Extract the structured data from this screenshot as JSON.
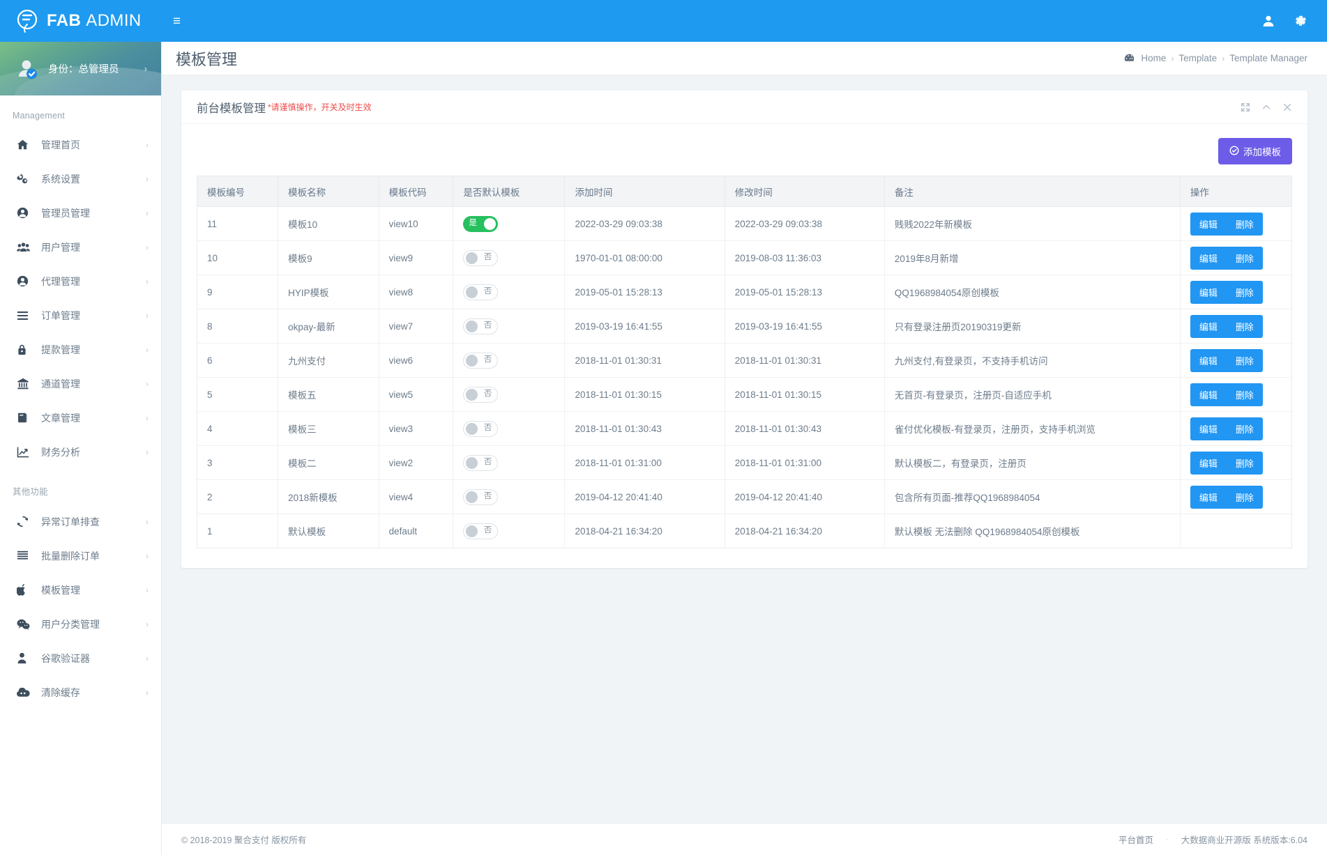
{
  "topbar": {
    "brand_bold": "FAB",
    "brand_light": "ADMIN",
    "menu_toggle": "≡",
    "icons": [
      {
        "name": "user-icon",
        "glyph": "user"
      },
      {
        "name": "gear-icon",
        "glyph": "gear"
      }
    ],
    "brand_color": "#1e9af0"
  },
  "sidebar": {
    "profile": {
      "label": "身份：总管理员",
      "arrow": "›"
    },
    "sections": [
      {
        "title": "Management",
        "items": [
          {
            "label": "管理首页",
            "icon": "home-icon",
            "arrow": "›"
          },
          {
            "label": "系统设置",
            "icon": "cogs-icon",
            "arrow": "›"
          },
          {
            "label": "管理员管理",
            "icon": "user-circle-icon",
            "arrow": "›"
          },
          {
            "label": "用户管理",
            "icon": "users-icon",
            "arrow": "›"
          },
          {
            "label": "代理管理",
            "icon": "user-circle-icon",
            "arrow": "›"
          },
          {
            "label": "订单管理",
            "icon": "list-icon",
            "arrow": "›"
          },
          {
            "label": "提款管理",
            "icon": "lock-icon",
            "arrow": "›"
          },
          {
            "label": "通道管理",
            "icon": "bank-icon",
            "arrow": "›"
          },
          {
            "label": "文章管理",
            "icon": "book-icon",
            "arrow": "›"
          },
          {
            "label": "财务分析",
            "icon": "chart-line-icon",
            "arrow": "›"
          }
        ]
      },
      {
        "title": "其他功能",
        "items": [
          {
            "label": "异常订单排查",
            "icon": "refresh-icon",
            "arrow": "›"
          },
          {
            "label": "批量删除订单",
            "icon": "bars-icon",
            "arrow": "›"
          },
          {
            "label": "模板管理",
            "icon": "apple-icon",
            "arrow": "›"
          },
          {
            "label": "用户分类管理",
            "icon": "wechat-icon",
            "arrow": "›"
          },
          {
            "label": "谷歌验证器",
            "icon": "person-icon",
            "arrow": "›"
          },
          {
            "label": "清除缓存",
            "icon": "cloud-icon",
            "arrow": "›"
          }
        ]
      }
    ]
  },
  "page": {
    "title": "模板管理",
    "breadcrumb": {
      "icon": "dashboard-icon",
      "crumbs": [
        "Home",
        "Template",
        "Template Manager"
      ],
      "separator": "›"
    }
  },
  "card": {
    "title": "前台模板管理",
    "warning": "*请谨慎操作，开关及时生效",
    "tools": [
      {
        "name": "expand-icon",
        "glyph": "expand"
      },
      {
        "name": "collapse-icon",
        "glyph": "chevron-up"
      },
      {
        "name": "close-icon",
        "glyph": "close"
      }
    ],
    "add_button": {
      "label": "添加模板",
      "icon": "check-circle-icon",
      "color": "#6c5ce7"
    }
  },
  "table": {
    "columns": [
      "模板编号",
      "模板名称",
      "模板代码",
      "是否默认模板",
      "添加时间",
      "修改时间",
      "备注",
      "操作"
    ],
    "switch_labels": {
      "on": "是",
      "off": "否"
    },
    "actions": {
      "edit": "编辑",
      "delete": "删除"
    },
    "rows": [
      {
        "id": "11",
        "name": "模板10",
        "code": "view10",
        "is_default": true,
        "created": "2022-03-29 09:03:38",
        "modified": "2022-03-29 09:03:38",
        "remark": "贱贱2022年新模板",
        "has_actions": true
      },
      {
        "id": "10",
        "name": "模板9",
        "code": "view9",
        "is_default": false,
        "created": "1970-01-01 08:00:00",
        "modified": "2019-08-03 11:36:03",
        "remark": "2019年8月新增",
        "has_actions": true
      },
      {
        "id": "9",
        "name": "HYIP模板",
        "code": "view8",
        "is_default": false,
        "created": "2019-05-01 15:28:13",
        "modified": "2019-05-01 15:28:13",
        "remark": "QQ1968984054原创模板",
        "has_actions": true
      },
      {
        "id": "8",
        "name": "okpay-最新",
        "code": "view7",
        "is_default": false,
        "created": "2019-03-19 16:41:55",
        "modified": "2019-03-19 16:41:55",
        "remark": "只有登录注册页20190319更新",
        "has_actions": true
      },
      {
        "id": "6",
        "name": "九州支付",
        "code": "view6",
        "is_default": false,
        "created": "2018-11-01 01:30:31",
        "modified": "2018-11-01 01:30:31",
        "remark": "九州支付,有登录页，不支持手机访问",
        "has_actions": true
      },
      {
        "id": "5",
        "name": "模板五",
        "code": "view5",
        "is_default": false,
        "created": "2018-11-01 01:30:15",
        "modified": "2018-11-01 01:30:15",
        "remark": "无首页-有登录页，注册页-自适应手机",
        "has_actions": true
      },
      {
        "id": "4",
        "name": "模板三",
        "code": "view3",
        "is_default": false,
        "created": "2018-11-01 01:30:43",
        "modified": "2018-11-01 01:30:43",
        "remark": "雀付优化模板-有登录页，注册页，支持手机浏览",
        "has_actions": true
      },
      {
        "id": "3",
        "name": "模板二",
        "code": "view2",
        "is_default": false,
        "created": "2018-11-01 01:31:00",
        "modified": "2018-11-01 01:31:00",
        "remark": "默认模板二，有登录页，注册页",
        "has_actions": true
      },
      {
        "id": "2",
        "name": "2018新模板",
        "code": "view4",
        "is_default": false,
        "created": "2019-04-12 20:41:40",
        "modified": "2019-04-12 20:41:40",
        "remark": "包含所有页面-推荐QQ1968984054",
        "has_actions": true
      },
      {
        "id": "1",
        "name": "默认模板",
        "code": "default",
        "is_default": false,
        "created": "2018-04-21 16:34:20",
        "modified": "2018-04-21 16:34:20",
        "remark": "默认模板 无法删除 QQ1968984054原创模板",
        "has_actions": false
      }
    ]
  },
  "footer": {
    "copyright": "© 2018-2019 聚合支付 版权所有",
    "link": "平台首页",
    "dot": "·",
    "version": "大数据商业开源版 系统版本:6.04"
  }
}
